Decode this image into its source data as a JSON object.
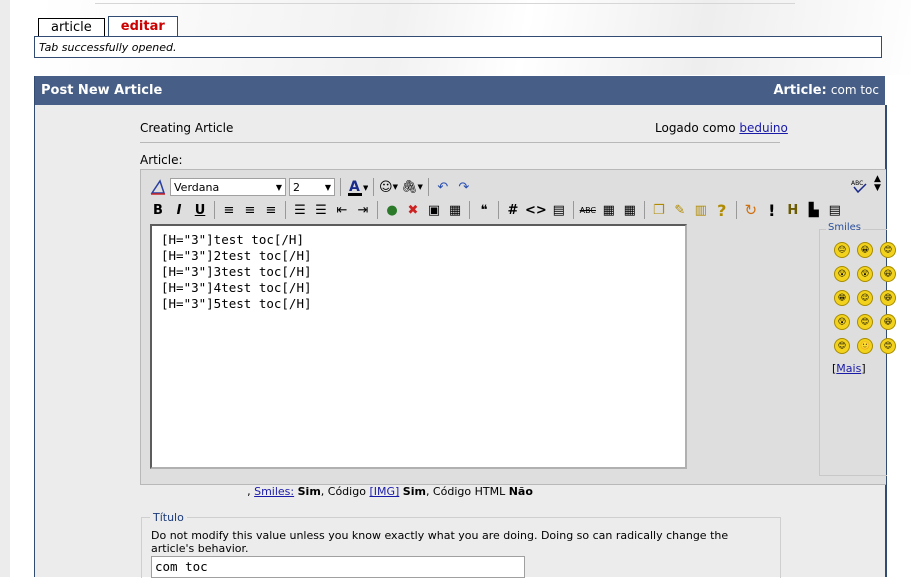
{
  "tabs": [
    {
      "label": "article",
      "active": false
    },
    {
      "label": "editar",
      "active": true
    }
  ],
  "message": "Tab successfully opened.",
  "panel": {
    "title": "Post New Article",
    "right_label": "Article:",
    "right_value": "com toc"
  },
  "creating": "Creating Article",
  "logged_in": {
    "label": "Logado como",
    "user": "beduino"
  },
  "article_label": "Article:",
  "toolbar": {
    "font_family": "Verdana",
    "font_size": "2",
    "bold": "B",
    "italic": "I",
    "underline": "U",
    "hash": "#",
    "code": "<>",
    "abc": "ABC",
    "question": "?",
    "exclamation": "!"
  },
  "editor_text": "[H=\"3\"]test toc[/H]\n[H=\"3\"]2test toc[/H]\n[H=\"3\"]3test toc[/H]\n[H=\"3\"]4test toc[/H]\n[H=\"3\"]5test toc[/H]",
  "smiles": {
    "legend": "Smiles",
    "more": "Mais",
    "faces": [
      "😐",
      "😀",
      "😊",
      "😮",
      "😲",
      "😃",
      "😁",
      "😉",
      "😄",
      "😮",
      "😊",
      "😄",
      "😊",
      "🙂",
      "😊"
    ]
  },
  "info": {
    "prefix": ",",
    "smiles_link": "Smiles:",
    "smiles_val": "Sim",
    "codigo": ", Código",
    "img_link": "[IMG]",
    "img_val": "Sim",
    "html": ", Código HTML",
    "html_val": "Não"
  },
  "titulo": {
    "legend": "Título",
    "description": "Do not modify this value unless you know exactly what you are doing. Doing so can radically change the article's behavior.",
    "value": "com toc"
  },
  "colors": {
    "header": "#475e86",
    "tab_active": "#cc0000",
    "link": "#1a1aa8"
  }
}
